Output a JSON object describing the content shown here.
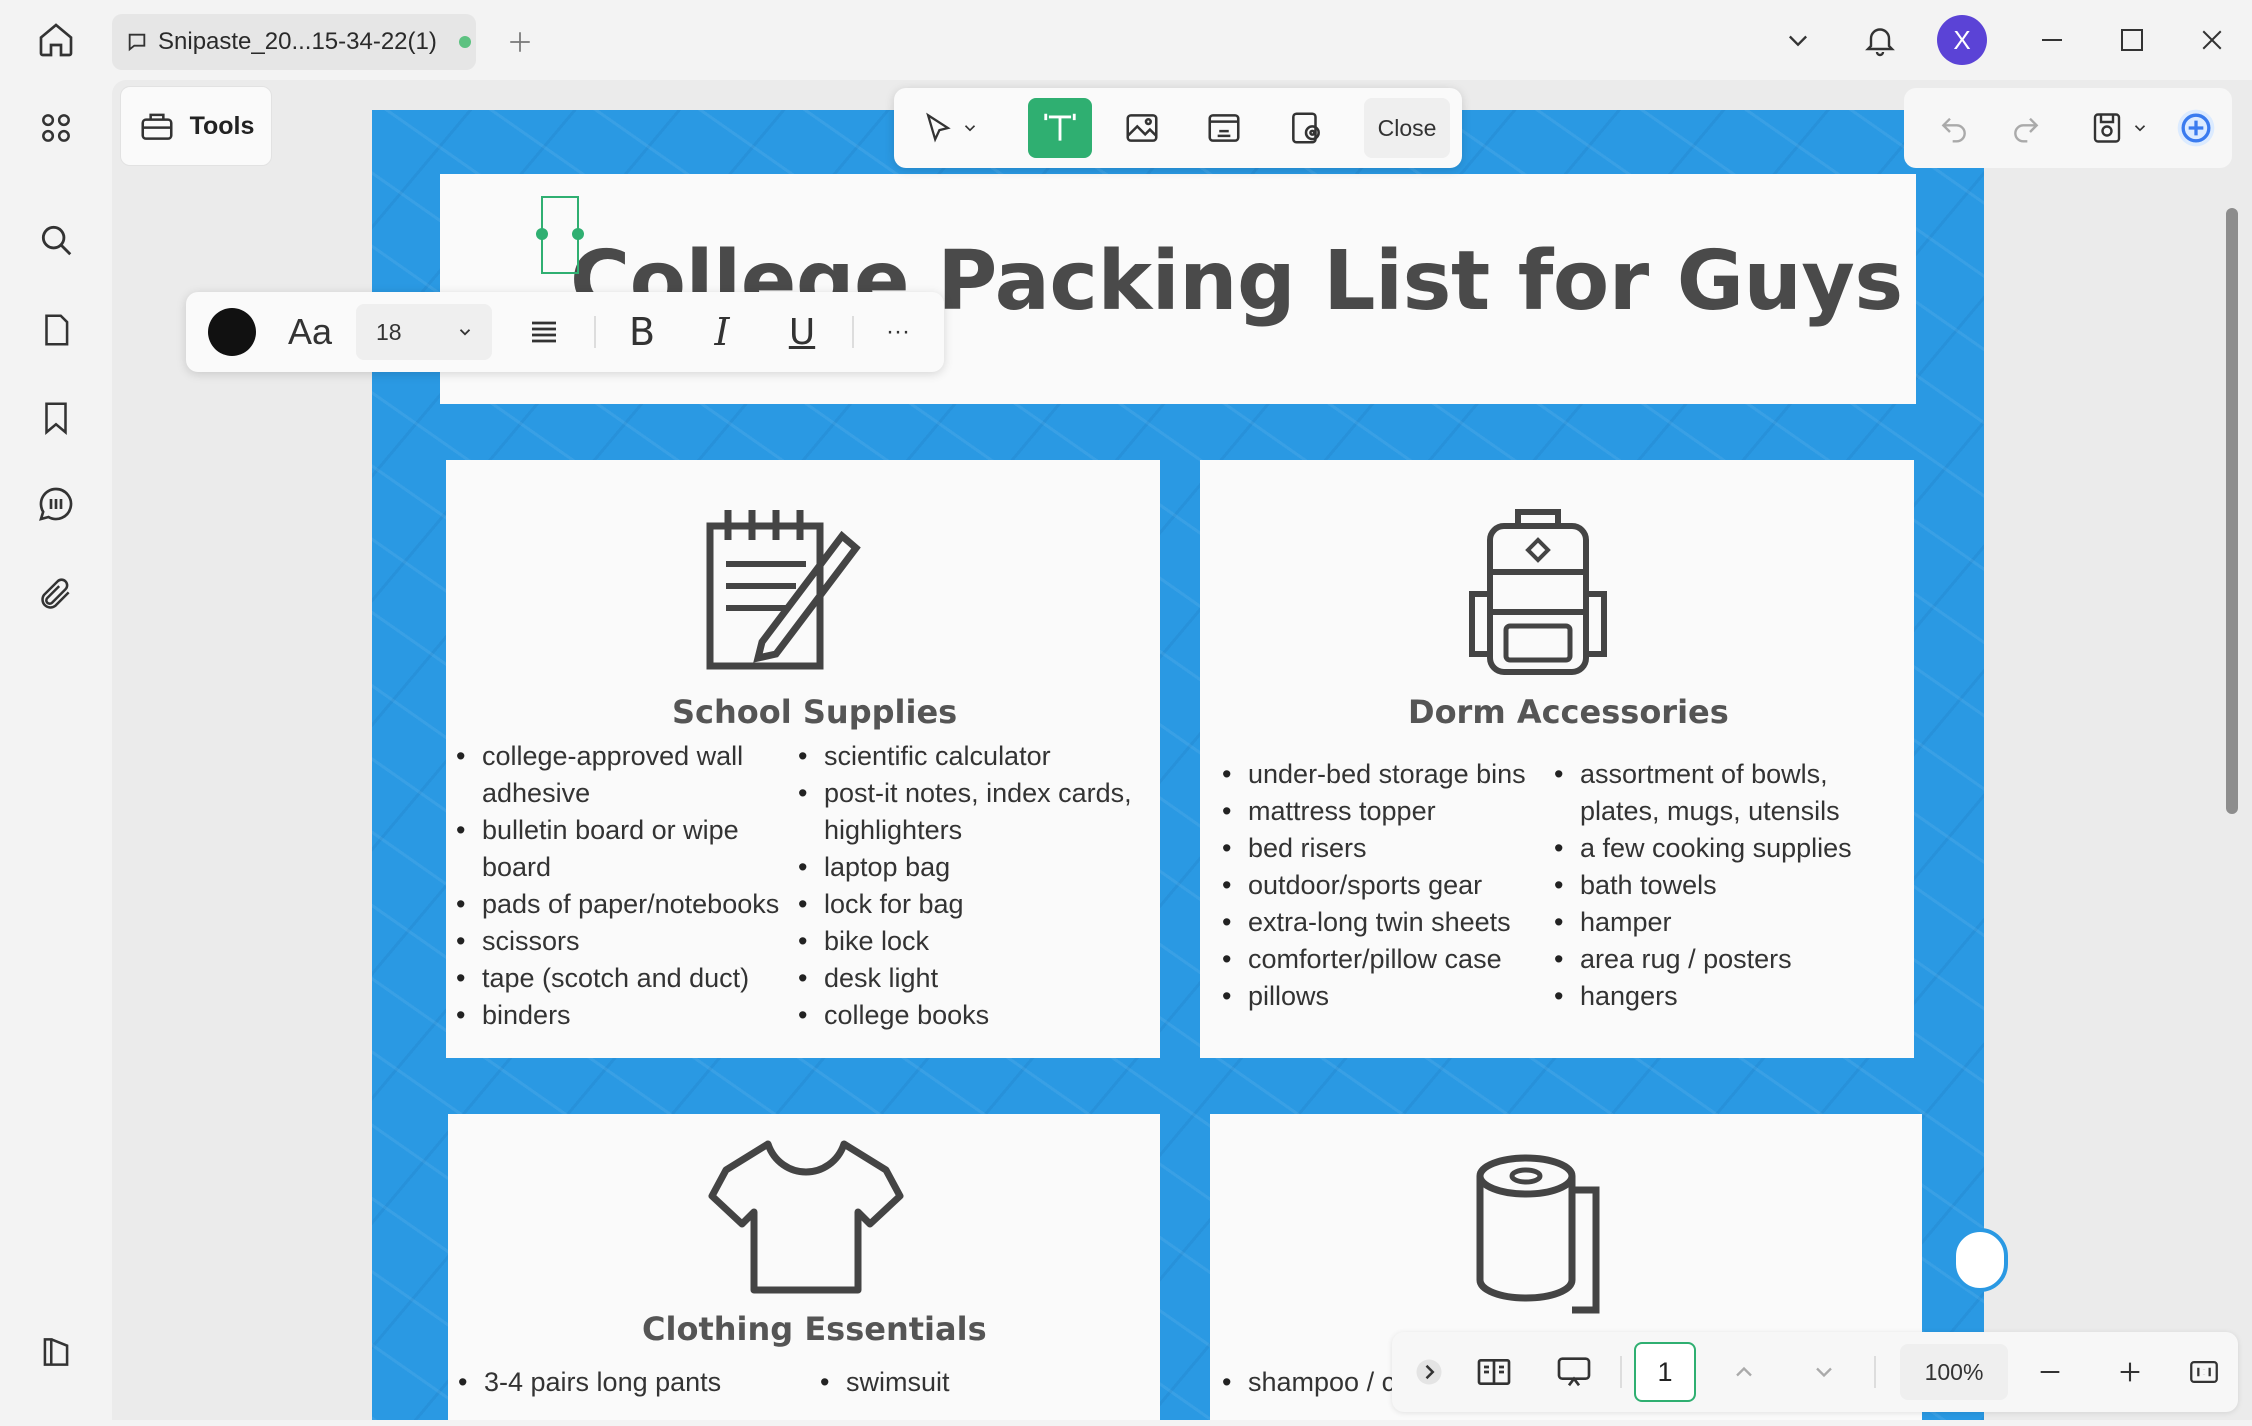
{
  "titlebar": {
    "tab_title": "Snipaste_20...15-34-22(1)",
    "avatar_letter": "X",
    "colors": {
      "avatar": "#5b43d6",
      "tab_status_dot": "#5dc281"
    }
  },
  "tools_label": "Tools",
  "main_toolbar": {
    "close_label": "Close",
    "active_tool": "text"
  },
  "format_toolbar": {
    "font_size": "18",
    "font_label": "Aa",
    "bold": "B",
    "italic": "I",
    "underline": "U",
    "more": "···"
  },
  "bottom_toolbar": {
    "page_number": "1",
    "zoom": "100%"
  },
  "document": {
    "title": "College Packing List for Guys",
    "sections": [
      {
        "title": "School Supplies",
        "icon": "notepad-pencil-icon",
        "col1": [
          "college-approved wall adhesive",
          "bulletin board or wipe board",
          "pads of paper/notebooks",
          "scissors",
          "tape (scotch and duct)",
          "binders"
        ],
        "col2": [
          "scientific calculator",
          "post-it notes, index cards, highlighters",
          "laptop bag",
          "lock for bag",
          "bike lock",
          "desk light",
          "college books"
        ]
      },
      {
        "title": "Dorm Accessories",
        "icon": "backpack-icon",
        "col1": [
          "under-bed storage bins",
          "mattress topper",
          "bed risers",
          "outdoor/sports gear",
          "extra-long twin sheets",
          "comforter/pillow case",
          "pillows"
        ],
        "col2": [
          "assortment of bowls, plates, mugs, utensils",
          "a few cooking supplies",
          "bath towels",
          "hamper",
          "area rug / posters",
          "hangers"
        ]
      },
      {
        "title": "Clothing Essentials",
        "icon": "tshirt-icon",
        "col1": [
          "3-4 pairs long pants"
        ],
        "col2": [
          "swimsuit"
        ]
      },
      {
        "title": "",
        "icon": "toilet-paper-icon",
        "col1": [
          "shampoo / conditioner"
        ],
        "col2": []
      }
    ]
  },
  "colors": {
    "accent_green": "#2faf71",
    "page_blue": "#2a99e3"
  }
}
